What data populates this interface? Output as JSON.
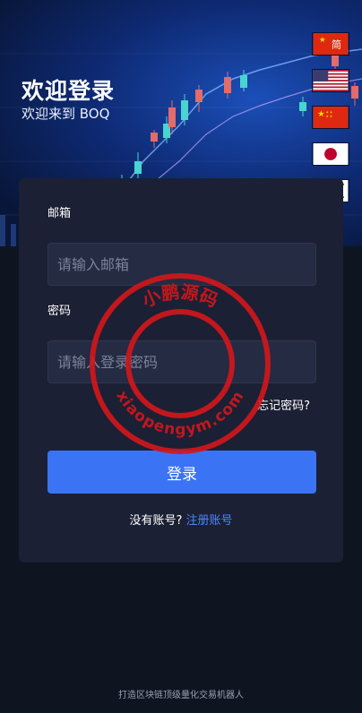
{
  "hero": {
    "title": "欢迎登录",
    "subtitle": "欢迎来到 BOQ"
  },
  "languages": [
    {
      "name": "cn-flag-icon",
      "label": "简"
    },
    {
      "name": "us-flag-icon",
      "label": ""
    },
    {
      "name": "cn-flag-icon",
      "label": ""
    },
    {
      "name": "jp-flag-icon",
      "label": ""
    },
    {
      "name": "kr-flag-icon",
      "label": ""
    }
  ],
  "form": {
    "email_label": "邮箱",
    "email_placeholder": "请输入邮箱",
    "email_value": "",
    "password_label": "密码",
    "password_placeholder": "请输入登录密码",
    "password_value": "",
    "forgot_label": "忘记密码?",
    "submit_label": "登录",
    "no_account_text": "没有账号? ",
    "register_link": "注册账号"
  },
  "footer": {
    "text": "打造区块链顶级量化交易机器人"
  },
  "watermark": {
    "top_text": "小鹏源码",
    "bottom_text": "xiaopengym.com"
  },
  "colors": {
    "accent": "#3a74f5",
    "link": "#4c86ff",
    "card_bg": "#1b2034",
    "page_bg": "#0f1421",
    "watermark": "#d4161b"
  }
}
